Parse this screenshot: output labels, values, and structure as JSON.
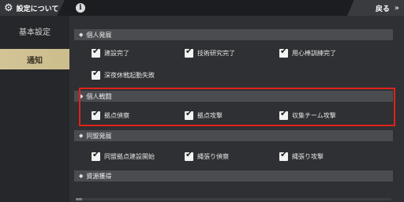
{
  "header": {
    "title": "設定について",
    "info_symbol": "i",
    "back_label": "戻る",
    "back_arrow": "»"
  },
  "sidebar": {
    "items": [
      {
        "label": "基本設定",
        "selected": false
      },
      {
        "label": "通知",
        "selected": true
      }
    ]
  },
  "sections": [
    {
      "label": "個人発展",
      "rows": [
        [
          {
            "label": "建設完了",
            "checked": true
          },
          {
            "label": "技術研究完了",
            "checked": true
          },
          {
            "label": "用心棒訓練完了",
            "checked": true
          }
        ],
        [
          {
            "label": "深夜休戦起動失敗",
            "checked": true
          }
        ]
      ]
    },
    {
      "label": "個人戦闘",
      "rows": [
        [
          {
            "label": "拠点偵察",
            "checked": true
          },
          {
            "label": "拠点攻撃",
            "checked": true
          },
          {
            "label": "収集チーム攻撃",
            "checked": true
          }
        ]
      ]
    },
    {
      "label": "同盟発展",
      "rows": [
        [
          {
            "label": "同盟拠点建設開始",
            "checked": true
          },
          {
            "label": "縄張り偵察",
            "checked": true
          },
          {
            "label": "縄張り攻撃",
            "checked": true
          }
        ]
      ]
    },
    {
      "label": "資源獲得",
      "rows": []
    }
  ],
  "icons": {
    "gear": "gear-icon",
    "diamond": "diamond-icon",
    "check": "checkmark-icon"
  },
  "colors": {
    "accent": "#cbbd8c",
    "highlight": "#e0221a"
  }
}
